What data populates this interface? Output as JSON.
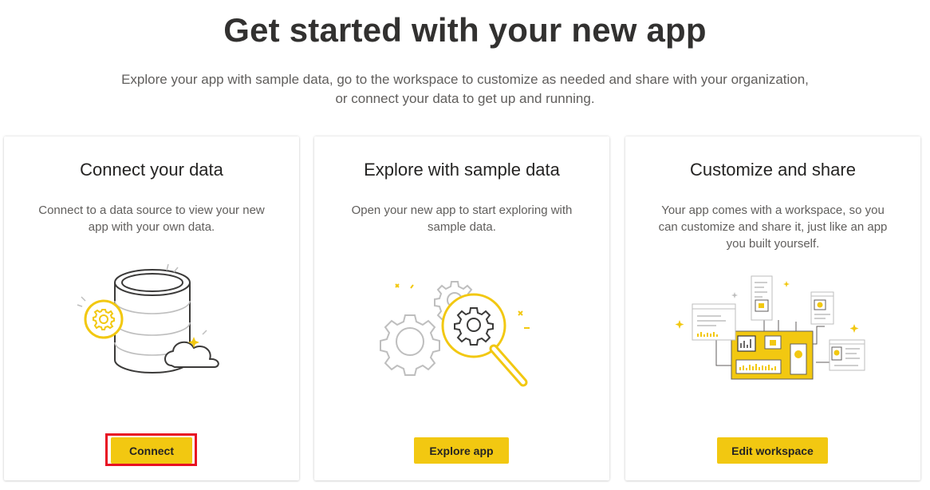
{
  "header": {
    "title": "Get started with your new app",
    "subtitle_line1": "Explore your app with sample data, go to the workspace to customize as needed and share with your organization,",
    "subtitle_line2": "or connect your data to get up and running."
  },
  "cards": [
    {
      "title": "Connect your data",
      "description": "Connect to a data source to view your new app with your own data.",
      "button_label": "Connect",
      "illustration": "database-cloud-gear-icon"
    },
    {
      "title": "Explore with sample data",
      "description": "Open your new app to start exploring with sample data.",
      "button_label": "Explore app",
      "illustration": "gears-magnifier-icon"
    },
    {
      "title": "Customize and share",
      "description": "Your app comes with a workspace, so you can customize and share it, just like an app you built yourself.",
      "button_label": "Edit workspace",
      "illustration": "workspace-diagram-icon"
    }
  ],
  "colors": {
    "accent_yellow": "#f2c811",
    "highlight_red": "#e81123",
    "text_primary": "#252423",
    "text_secondary": "#605e5c",
    "illustration_gray": "#bebebe",
    "illustration_dark": "#3b3a39"
  }
}
